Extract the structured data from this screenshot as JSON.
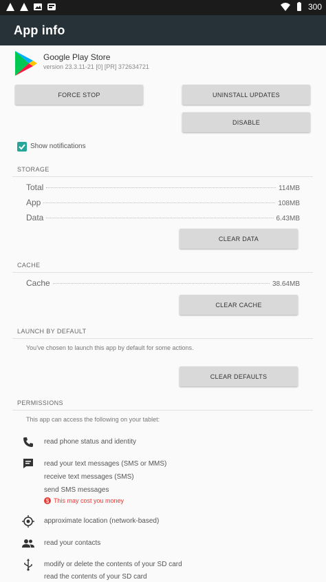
{
  "status_bar": {
    "battery_level": "300",
    "icons": [
      "warning-icon",
      "warning-icon",
      "photo-icon",
      "notification-icon",
      "wifi-icon",
      "battery-icon"
    ]
  },
  "app_bar": {
    "title": "App info"
  },
  "app": {
    "name": "Google Play Store",
    "version": "version 23.3.11-21 [0] [PR] 372634721"
  },
  "buttons": {
    "force_stop": "FORCE STOP",
    "uninstall_updates": "UNINSTALL UPDATES",
    "disable": "DISABLE",
    "clear_data": "CLEAR DATA",
    "clear_cache": "CLEAR CACHE",
    "clear_defaults": "CLEAR DEFAULTS"
  },
  "notifications": {
    "label": "Show notifications",
    "checked": true
  },
  "storage": {
    "header": "STORAGE",
    "rows": [
      {
        "label": "Total",
        "value": "114MB"
      },
      {
        "label": "App",
        "value": "108MB"
      },
      {
        "label": "Data",
        "value": "6.43MB"
      }
    ]
  },
  "cache": {
    "header": "CACHE",
    "rows": [
      {
        "label": "Cache",
        "value": "38.64MB"
      }
    ]
  },
  "launch_default": {
    "header": "LAUNCH BY DEFAULT",
    "text": "You've chosen to launch this app by default for some actions."
  },
  "permissions": {
    "header": "PERMISSIONS",
    "intro": "This app can access the following on your tablet:",
    "items": [
      {
        "icon": "phone-icon",
        "lines": [
          "read phone status and identity"
        ]
      },
      {
        "icon": "message-icon",
        "lines": [
          "read your text messages (SMS or MMS)",
          "receive text messages (SMS)",
          "send SMS messages"
        ],
        "warning": "This may cost you money"
      },
      {
        "icon": "location-icon",
        "lines": [
          "approximate location (network-based)"
        ]
      },
      {
        "icon": "contacts-icon",
        "lines": [
          "read your contacts"
        ]
      },
      {
        "icon": "usb-icon",
        "lines": [
          "modify or delete the contents of your SD card",
          "read the contents of your SD card"
        ]
      }
    ]
  },
  "colors": {
    "status_bar": "#1b1b1b",
    "app_bar": "#263238",
    "checkbox": "#26a69a",
    "warning": "#e53935",
    "button": "#d9d9d9"
  }
}
